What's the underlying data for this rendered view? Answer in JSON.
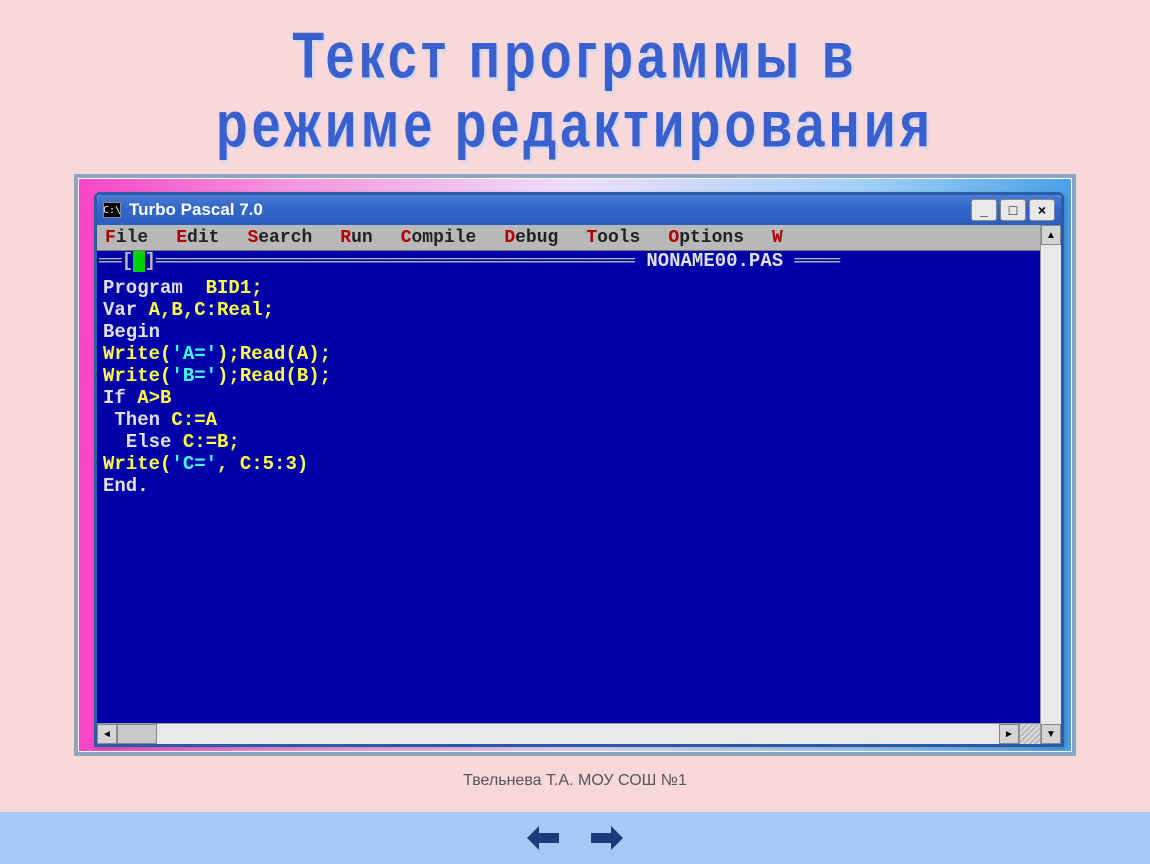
{
  "slide": {
    "title_line1": "Текст программы в",
    "title_line2": "режиме редактирования",
    "footer": "Твельнева Т.А. МОУ СОШ №1"
  },
  "window": {
    "icon_label": "C:\\",
    "title": "Turbo Pascal 7.0",
    "buttons": {
      "minimize": "_",
      "maximize": "□",
      "close": "×"
    }
  },
  "menubar": {
    "items": [
      {
        "hot": "F",
        "rest": "ile"
      },
      {
        "hot": "E",
        "rest": "dit"
      },
      {
        "hot": "S",
        "rest": "earch"
      },
      {
        "hot": "R",
        "rest": "un"
      },
      {
        "hot": "C",
        "rest": "ompile"
      },
      {
        "hot": "D",
        "rest": "ebug"
      },
      {
        "hot": "T",
        "rest": "ools"
      },
      {
        "hot": "O",
        "rest": "ptions"
      },
      {
        "hot": "W",
        "rest": ""
      }
    ]
  },
  "editor": {
    "filename": "NONAME00.PAS",
    "frame_left": "══[",
    "frame_mark": "▪",
    "frame_mid1": "]══════════════════════════════════════════ ",
    "frame_mid2": " ════",
    "code_lines": [
      [
        {
          "c": "cw",
          "t": "Program  "
        },
        {
          "c": "cy",
          "t": "BID1;"
        }
      ],
      [
        {
          "c": "cw",
          "t": "Var "
        },
        {
          "c": "cy",
          "t": "A,B,C:Real;"
        }
      ],
      [
        {
          "c": "cw",
          "t": "Begin"
        }
      ],
      [
        {
          "c": "cy",
          "t": "Write("
        },
        {
          "c": "cc",
          "t": "'A='"
        },
        {
          "c": "cy",
          "t": ");Read(A);"
        }
      ],
      [
        {
          "c": "cy",
          "t": "Write("
        },
        {
          "c": "cc",
          "t": "'B='"
        },
        {
          "c": "cy",
          "t": ");Read(B);"
        }
      ],
      [
        {
          "c": "cw",
          "t": "If "
        },
        {
          "c": "cy",
          "t": "A>B"
        }
      ],
      [
        {
          "c": "cw",
          "t": " Then "
        },
        {
          "c": "cy",
          "t": "C:=A"
        }
      ],
      [
        {
          "c": "cw",
          "t": "  Else "
        },
        {
          "c": "cy",
          "t": "C:=B;"
        }
      ],
      [
        {
          "c": "cy",
          "t": "Write("
        },
        {
          "c": "cc",
          "t": "'C='"
        },
        {
          "c": "cy",
          "t": ", C:5:3)"
        }
      ],
      [
        {
          "c": "cw",
          "t": "End"
        },
        {
          "c": "cy",
          "t": "."
        }
      ]
    ]
  },
  "nav": {
    "prev": "prev",
    "next": "next"
  }
}
